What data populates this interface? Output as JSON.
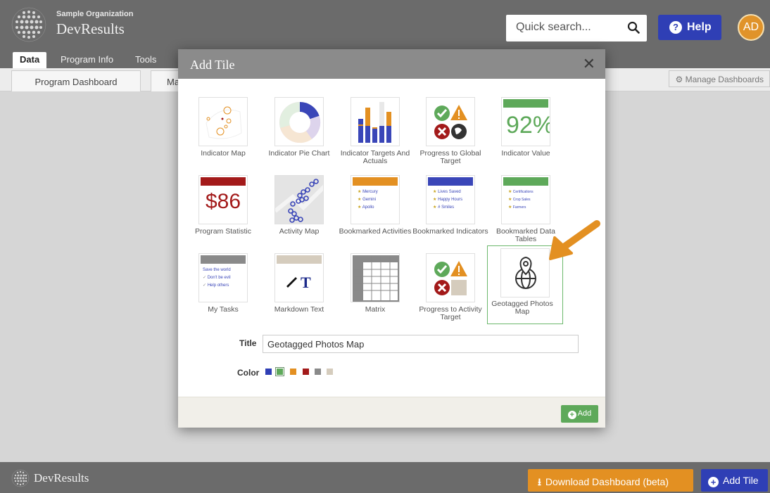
{
  "header": {
    "org_name": "Sample Organization",
    "brand": "DevResults",
    "search_placeholder": "Quick search...",
    "help_label": "Help",
    "avatar_initials": "AD"
  },
  "nav": {
    "tabs": [
      {
        "label": "Data",
        "active": true
      },
      {
        "label": "Program Info",
        "active": false
      },
      {
        "label": "Tools",
        "active": false
      }
    ],
    "subtabs": [
      {
        "label": "Program Dashboard"
      },
      {
        "label": "Ma"
      }
    ],
    "manage_label": "Manage Dashboards"
  },
  "modal": {
    "title": "Add Tile",
    "close_glyph": "✕",
    "tiles": [
      {
        "label": "Indicator Map",
        "icon": "indicator-map-icon"
      },
      {
        "label": "Indicator Pie Chart",
        "icon": "pie-chart-icon"
      },
      {
        "label": "Indicator Targets And Actuals",
        "icon": "bar-chart-icon"
      },
      {
        "label": "Progress to Global Target",
        "icon": "progress-status-icon"
      },
      {
        "label": "Indicator Value",
        "icon": "value-icon",
        "value_text": "92%"
      },
      {
        "label": "Program Statistic",
        "icon": "statistic-icon",
        "value_text": "$86"
      },
      {
        "label": "Activity Map",
        "icon": "activity-map-icon"
      },
      {
        "label": "Bookmarked Activities",
        "icon": "bookmark-list-icon",
        "items": [
          "Mercury",
          "Gemini",
          "Apollo"
        ]
      },
      {
        "label": "Bookmarked Indicators",
        "icon": "bookmark-list-icon",
        "items": [
          "Lives Saved",
          "Happy Hours",
          "# Smiles"
        ]
      },
      {
        "label": "Bookmarked Data Tables",
        "icon": "bookmark-list-icon",
        "items": [
          "Certifications",
          "Crop Sales",
          "Farmers"
        ]
      },
      {
        "label": "My Tasks",
        "icon": "tasks-icon",
        "items": [
          "Save the world",
          "Don't be evil",
          "Help others"
        ]
      },
      {
        "label": "Markdown Text",
        "icon": "markdown-icon"
      },
      {
        "label": "Matrix",
        "icon": "matrix-icon"
      },
      {
        "label": "Progress to Activity Target",
        "icon": "progress-status-icon"
      },
      {
        "label": "Geotagged Photos Map",
        "icon": "geotag-globe-icon",
        "selected": true
      }
    ],
    "title_label": "Title",
    "title_value": "Geotagged Photos Map",
    "color_label": "Color",
    "colors": [
      "#2f3fb5",
      "#5ea95a",
      "#e39022",
      "#a31a1a",
      "#8a8a8a",
      "#d5ccbd"
    ],
    "selected_color": "#5ea95a",
    "add_label": "Add"
  },
  "footer": {
    "brand": "DevResults",
    "download_label": "Download Dashboard (beta)",
    "add_tile_label": "Add Tile"
  },
  "colors": {
    "header_bg": "#6b6b6b",
    "accent_blue": "#2f3fb5",
    "accent_orange": "#e39022",
    "accent_green": "#5ea95a"
  }
}
